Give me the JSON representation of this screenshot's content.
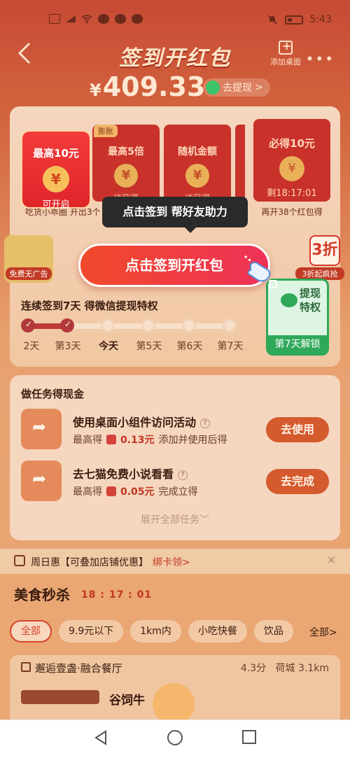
{
  "status_bar": {
    "time": "5:43"
  },
  "header": {
    "title": "签到开红包",
    "add_desktop": "添加桌面",
    "balance": "409.33",
    "balance_currency": "¥",
    "withdraw_label": "去提现",
    "withdraw_chevron": ">"
  },
  "envelopes": [
    {
      "title": "最高5倍",
      "status": "待获得",
      "tag": "膨胀"
    },
    {
      "title": "随机金额",
      "status": "待获得"
    }
  ],
  "highlight_envelope": {
    "title": "最高10元",
    "status": "可开启",
    "caption": "吃货小乖圈  开出3个"
  },
  "big_envelope": {
    "title": "必得10元",
    "countdown": "剩18:17:01",
    "caption": "再开38个红包得"
  },
  "coin_symbol": "¥",
  "tooltip": "点击签到 帮好友助力",
  "cta_label": "点击签到开红包",
  "side_left_label": "免费无广告",
  "side_right": {
    "badge": "3折",
    "label": "3折起疯抢"
  },
  "streak": {
    "title": "连续签到7天 得微信提现特权",
    "days": [
      "2天",
      "第3天",
      "今天",
      "第5天",
      "第6天",
      "第7天"
    ],
    "reward_title": "提现特权",
    "reward_unlock": "第7天解锁"
  },
  "tasks": {
    "title": "做任务得现金",
    "items": [
      {
        "name": "使用桌面小组件访问活动",
        "prefix": "最高得",
        "amount": "0.13元",
        "desc": "添加并使用后得",
        "button": "去使用"
      },
      {
        "name": "去七猫免费小说看看",
        "prefix": "最高得",
        "amount": "0.05元",
        "desc": "完成立得",
        "button": "去完成"
      }
    ],
    "expand_label": "展开全部任务",
    "expand_chevron": "﹀"
  },
  "promo": {
    "label": "周日惠【可叠加店铺优惠】",
    "link": "绑卡领>",
    "close": "×"
  },
  "flash_sale": {
    "title": "美食秒杀",
    "time": "18 : 17 : 01"
  },
  "filters": [
    "全部",
    "9.9元以下",
    "1km内",
    "小吃快餐",
    "饮品"
  ],
  "filters_more": "全部>",
  "shop": {
    "name": "邂逅壹盏·融合餐厅",
    "score": "4.3分",
    "distance": "荷城 3.1km",
    "dish": "谷饲牛"
  },
  "colors": {
    "accent_red": "#c8322b",
    "cta": "#f04a2b",
    "wechat_green": "#2fa85a"
  }
}
